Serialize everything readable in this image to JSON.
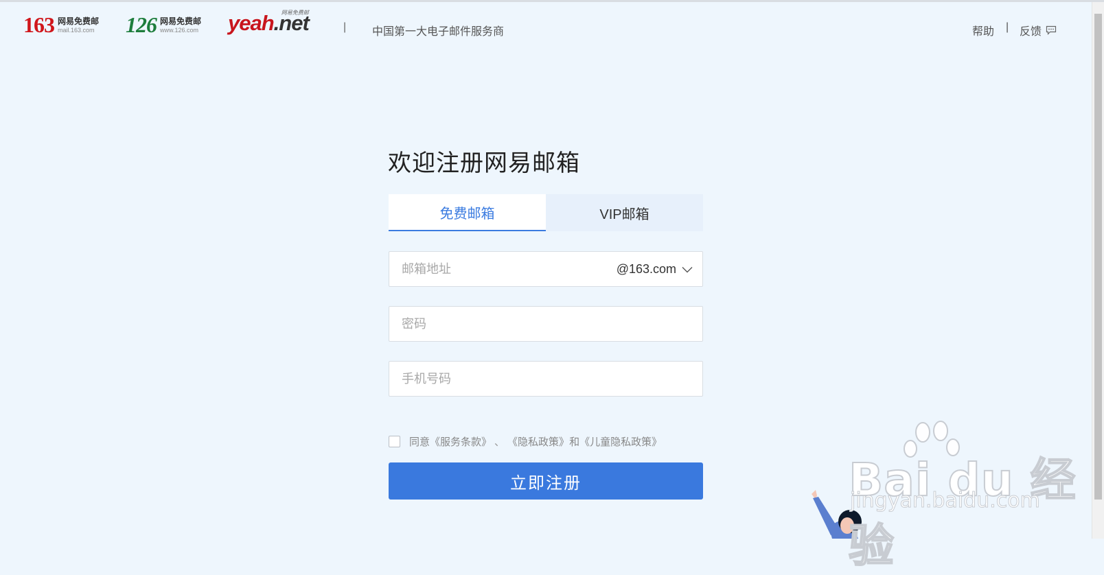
{
  "header": {
    "logos": [
      {
        "number": "163",
        "cn": "网易免费邮",
        "domain": "mail.163.com"
      },
      {
        "number": "126",
        "cn": "网易免费邮",
        "domain": "www.126.com"
      },
      {
        "brand": "yeah",
        "suffix": ".net",
        "tagline": "网易免费邮"
      }
    ],
    "separator": "|",
    "slogan": "中国第一大电子邮件服务商",
    "help": "帮助",
    "feedback": "反馈"
  },
  "form": {
    "title": "欢迎注册网易邮箱",
    "tabs": [
      {
        "label": "免费邮箱",
        "active": true
      },
      {
        "label": "VIP邮箱",
        "active": false
      }
    ],
    "email_placeholder": "邮箱地址",
    "email_value": "",
    "domain": "@163.com",
    "password_placeholder": "密码",
    "password_value": "",
    "phone_placeholder": "手机号码",
    "phone_value": "",
    "agree": {
      "checked": false,
      "prefix": "同意",
      "terms": "《服务条款》",
      "sep": "、",
      "privacy": "《隐私政策》",
      "and": "和",
      "child_privacy": "《儿童隐私政策》"
    },
    "submit_label": "立即注册"
  },
  "watermark": {
    "text": "Bai du 经验",
    "url": "jingyan.baidu.com"
  },
  "colors": {
    "accent": "#3a79de",
    "background": "#eef6fd",
    "brand_163": "#d0161b",
    "brand_126": "#1d7d3c"
  }
}
